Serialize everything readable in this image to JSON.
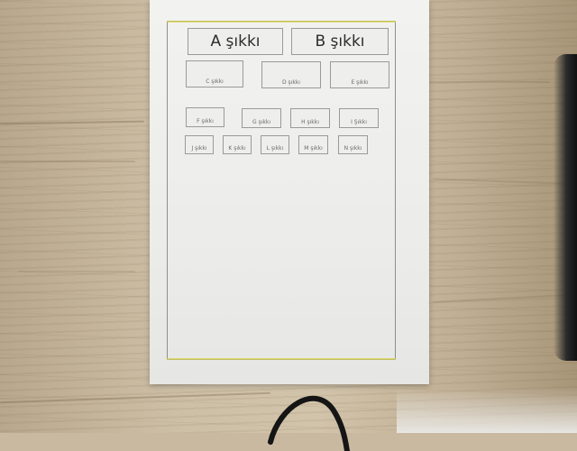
{
  "labels": {
    "a": "A şıkkı",
    "b": "B şıkkı",
    "c": "C şıkkı",
    "d": "D şıkkı",
    "e": "E şıkkı",
    "f": "F şıkkı",
    "g": "G şıkkı",
    "h": "H şıkkı",
    "i": "I Şıkkı",
    "j": "J şıkkı",
    "k": "K şıkkı",
    "l": "L şıkkı",
    "m": "M şıkkı",
    "n": "N şıkkı"
  }
}
